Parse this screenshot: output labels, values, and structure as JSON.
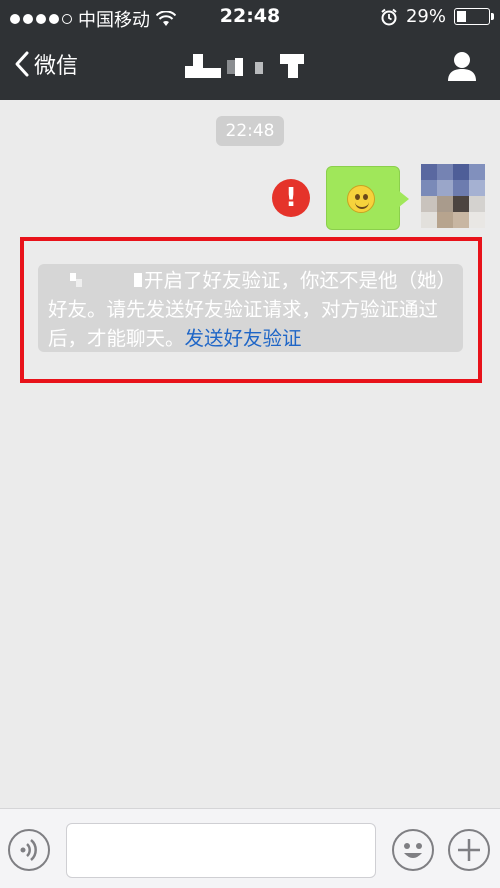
{
  "status_bar": {
    "carrier": "中国移动",
    "time": "22:48",
    "battery": "29%",
    "battery_level": 0.29
  },
  "nav": {
    "back_label": "微信"
  },
  "chat": {
    "timestamp": "22:48",
    "error_glyph": "!",
    "system_message_text": "开启了好友验证，你还不是他（她）好友。请先发送好友验证请求，对方验证通过后，才能聊天。",
    "system_message_link": "发送好友验证"
  },
  "colors": {
    "nav_bg": "#2f3235",
    "chat_bg": "#ebebeb",
    "outgoing_bubble": "#a0e75a",
    "error_red": "#e5332a",
    "highlight_red": "#e8121a",
    "link_blue": "#1f66c7"
  },
  "icons": {
    "back": "chevron-left-icon",
    "profile": "person-icon",
    "wifi": "wifi-icon",
    "alarm": "alarm-icon",
    "voice": "voice-icon",
    "emoji": "smiley-icon",
    "plus": "plus-icon"
  }
}
